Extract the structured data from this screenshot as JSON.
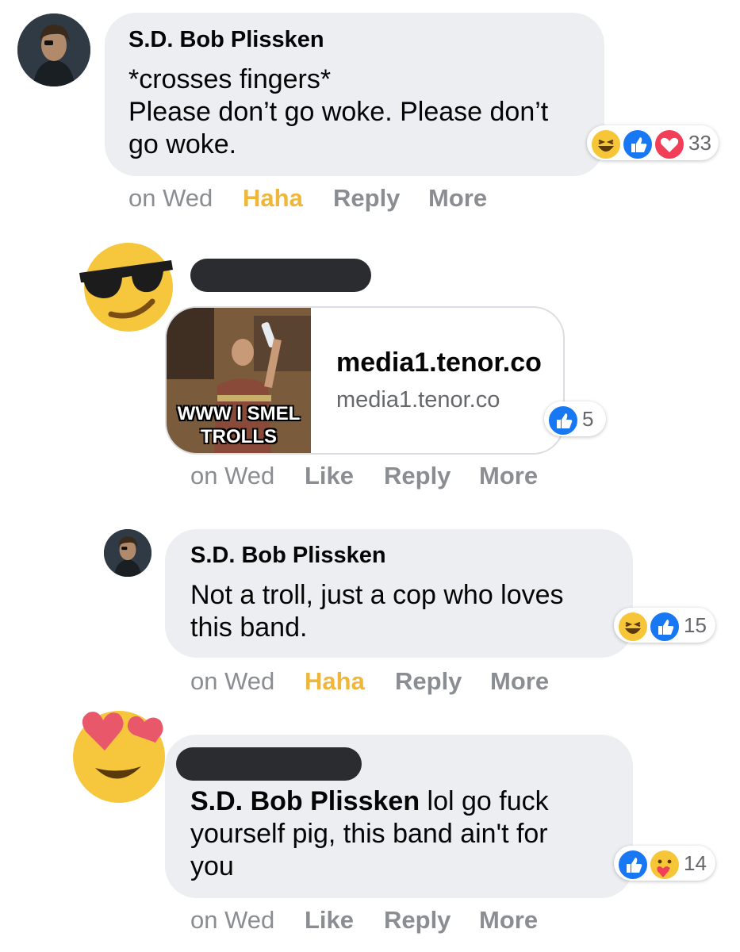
{
  "comments": [
    {
      "author": "S.D. Bob Plissken",
      "text_line1": "*crosses fingers*",
      "text_line2": "Please don’t go woke. Please don’t",
      "text_line3": "go woke.",
      "reaction_count": "33",
      "reactions": [
        "haha",
        "like",
        "love"
      ],
      "actions": {
        "time": "on Wed",
        "react": "Haha",
        "reply": "Reply",
        "more": "More"
      }
    },
    {
      "author_redacted": true,
      "link": {
        "gif_caption_line1": "WWW I SMEL",
        "gif_caption_line2": "TROLLS",
        "title": "media1.tenor.co",
        "domain": "media1.tenor.co"
      },
      "reaction_count": "5",
      "reactions": [
        "like"
      ],
      "actions": {
        "time": "on Wed",
        "react": "Like",
        "reply": "Reply",
        "more": "More"
      }
    },
    {
      "author": "S.D. Bob Plissken",
      "text_line1": "Not a troll, just a cop who loves",
      "text_line2": "this band.",
      "reaction_count": "15",
      "reactions": [
        "haha",
        "like"
      ],
      "actions": {
        "time": "on Wed",
        "react": "Haha",
        "reply": "Reply",
        "more": "More"
      }
    },
    {
      "author_redacted": true,
      "mention": "S.D. Bob Plissken",
      "text_line1_rest": " lol go fuck",
      "text_line2": "yourself pig, this band ain't for",
      "text_line3": "you",
      "reaction_count": "14",
      "reactions": [
        "like",
        "care"
      ],
      "actions": {
        "time": "on Wed",
        "react": "Like",
        "reply": "Reply",
        "more": "More"
      }
    }
  ],
  "colors": {
    "bubble": "#eceef1",
    "haha_active": "#f0b63a",
    "action_gray": "#8a8d91",
    "like_blue": "#1877f2",
    "love_red": "#f33e58",
    "emoji_yellow": "#f7c638"
  }
}
